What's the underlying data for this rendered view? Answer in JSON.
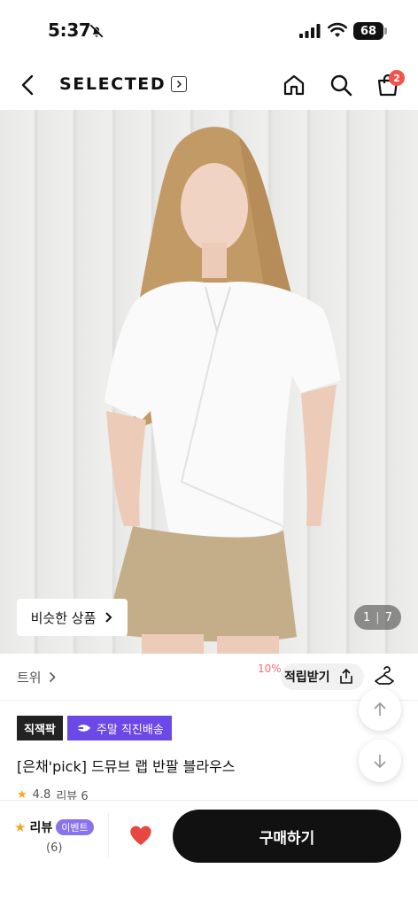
{
  "status_bar": {
    "time": "5:37",
    "battery": "68",
    "icons": [
      "bell-off-icon",
      "signal-icon",
      "wifi-icon",
      "battery-icon"
    ]
  },
  "nav": {
    "brand": "SELECTED",
    "cart_count": "2",
    "icons": [
      "back-icon",
      "home-icon",
      "search-icon",
      "shopping-bag-icon"
    ]
  },
  "hero": {
    "similar_button": "비슷한 상품",
    "counter_current": "1",
    "counter_separator": "|",
    "counter_total": "7"
  },
  "info_row": {
    "brand_link": "트위",
    "percent": "10%",
    "reward_button": "적립받기"
  },
  "badges": {
    "direct": "직잭팍",
    "delivery": "주말 직진배송"
  },
  "product": {
    "title": "[은채'pick] 드뮤브 랩 반팔 블라우스",
    "rating": "4.8",
    "review_label": "리뷰 6"
  },
  "bottom_bar": {
    "review_label": "리뷰",
    "event_badge": "이벤트",
    "review_count": "(6)",
    "buy_button": "구매하기"
  },
  "colors": {
    "accent_purple": "#6b49e6",
    "heart_red": "#e8473f",
    "badge_red": "#f2544b",
    "buy_button": "#111111"
  }
}
